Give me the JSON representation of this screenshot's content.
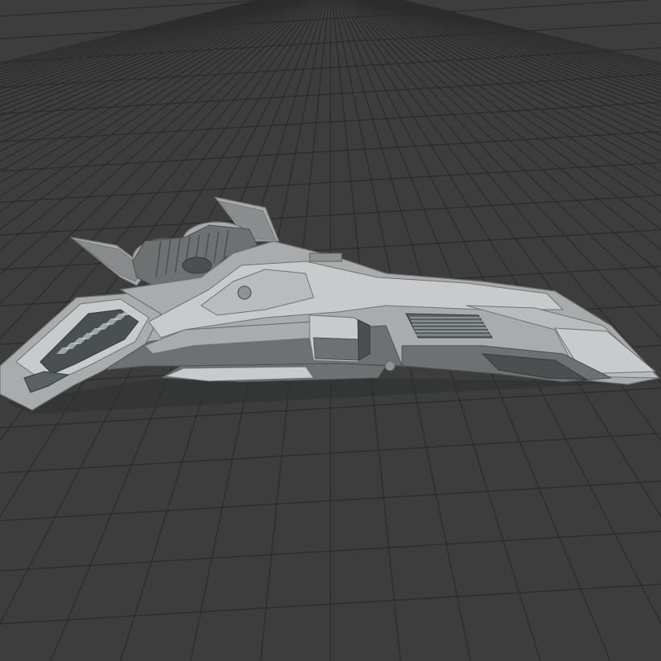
{
  "viewport": {
    "kind": "3d-viewport",
    "background_color": "#3d3d3d",
    "grid_line_color": "#2c2c2c",
    "grid": "on"
  },
  "model": {
    "name": "spaceship",
    "shading": "solid-gray",
    "base_color": "#a9acac",
    "highlight_color": "#c8cbcb",
    "shadow_color": "#6d7172",
    "dark_color": "#4a4f50",
    "vent_color": "#5b6061"
  }
}
